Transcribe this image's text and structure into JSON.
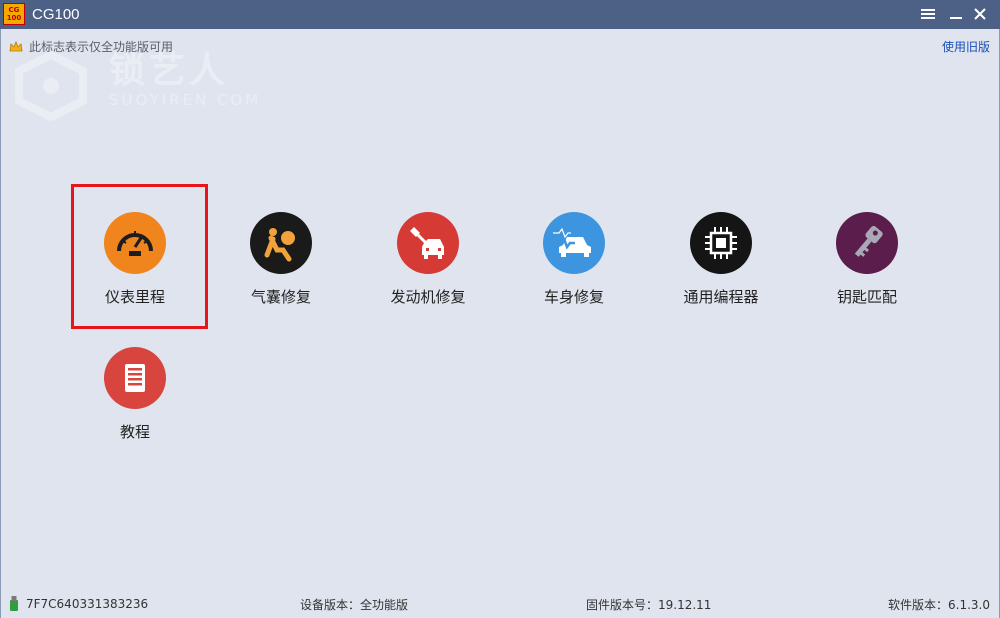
{
  "window": {
    "logo_line1": "CG",
    "logo_line2": "100",
    "title": "CG100"
  },
  "header": {
    "notice": "此标志表示仅全功能版可用",
    "use_old_version": "使用旧版"
  },
  "watermark": {
    "cn": "锁艺人",
    "en": "SUOYIREN.COM"
  },
  "tiles": [
    {
      "label": "仪表里程",
      "icon": "speedometer-icon",
      "color": "#f0841d",
      "selected": true
    },
    {
      "label": "气囊修复",
      "icon": "airbag-icon",
      "color": "#1a1a1a",
      "selected": false
    },
    {
      "label": "发动机修复",
      "icon": "engine-repair-icon",
      "color": "#d63a35",
      "selected": false
    },
    {
      "label": "车身修复",
      "icon": "car-body-icon",
      "color": "#3d95e0",
      "selected": false
    },
    {
      "label": "通用编程器",
      "icon": "chip-icon",
      "color": "#151515",
      "selected": false
    },
    {
      "label": "钥匙匹配",
      "icon": "key-icon",
      "color": "#5b1d4b",
      "selected": false
    },
    {
      "label": "教程",
      "icon": "document-icon",
      "color": "#d8453e",
      "selected": false
    }
  ],
  "status": {
    "device_id": "7F7C640331383236",
    "device_version": "设备版本：全功能版",
    "firmware_version": "固件版本号：19.12.11",
    "software_version": "软件版本：6.1.3.0"
  }
}
